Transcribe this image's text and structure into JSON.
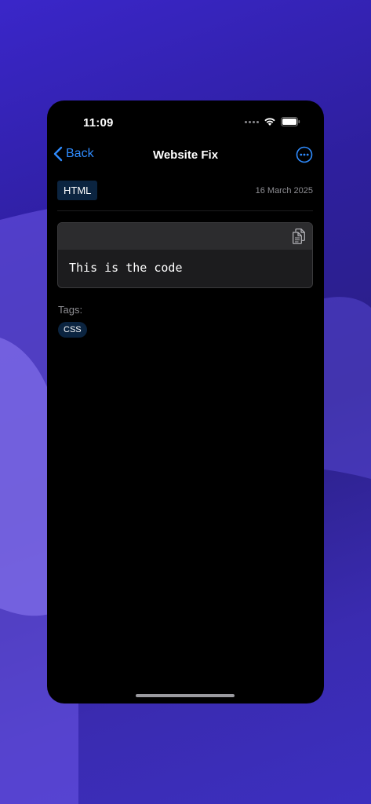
{
  "status_bar": {
    "time": "11:09"
  },
  "nav": {
    "back_label": "Back",
    "title": "Website Fix",
    "accent_color": "#2f8cff"
  },
  "snippet": {
    "language": "HTML",
    "date": "16 March 2025",
    "code": "This is the code"
  },
  "tags": {
    "label": "Tags:",
    "items": [
      "CSS"
    ]
  },
  "icons": {
    "back": "chevron-left-icon",
    "more": "ellipsis-circle-icon",
    "copy": "copy-icon",
    "wifi": "wifi-icon",
    "battery": "battery-icon"
  }
}
